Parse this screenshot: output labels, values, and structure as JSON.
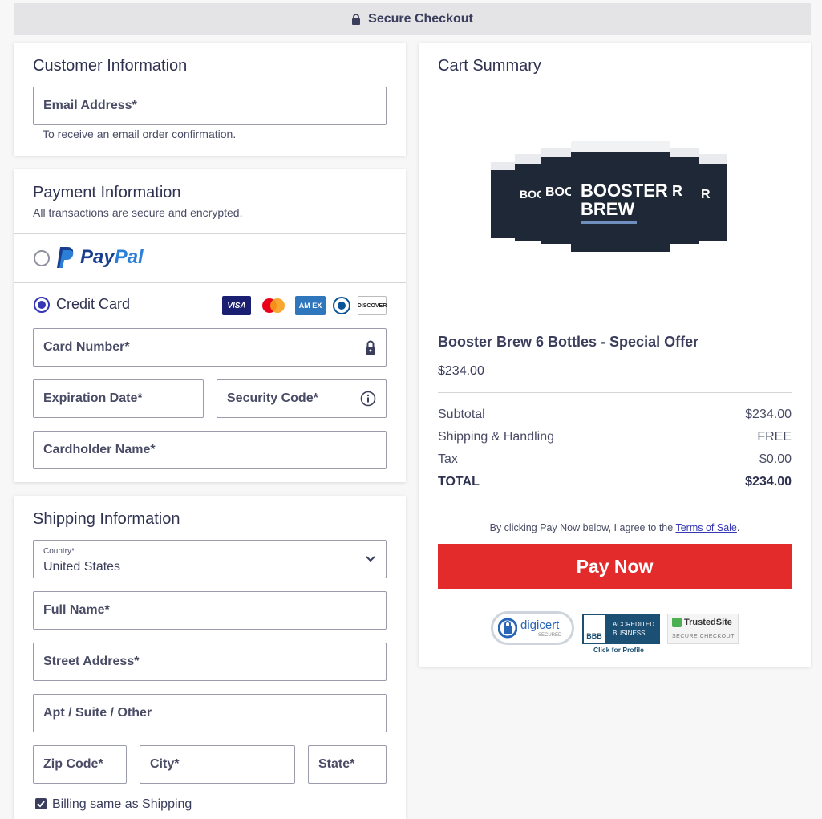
{
  "topbar": {
    "title": "Secure Checkout"
  },
  "customer": {
    "title": "Customer Information",
    "email_label": "Email Address*",
    "email_hint": "To receive an email order confirmation."
  },
  "payment": {
    "title": "Payment Information",
    "subtitle": "All transactions are secure and encrypted.",
    "paypal_pay": "Pay",
    "paypal_pal": "Pal",
    "credit_label": "Credit Card",
    "card_logos": {
      "visa": "VISA",
      "amex": "AM EX",
      "discover": "DISCOVER"
    },
    "card_number_label": "Card Number*",
    "expiration_label": "Expiration Date*",
    "security_label": "Security Code*",
    "cardholder_label": "Cardholder Name*"
  },
  "shipping": {
    "title": "Shipping Information",
    "country_small_label": "Country*",
    "country_value": "United States",
    "full_name_label": "Full Name*",
    "street_label": "Street Address*",
    "apt_label": "Apt / Suite / Other",
    "zip_label": "Zip Code*",
    "city_label": "City*",
    "state_label": "State*",
    "billing_same_label": "Billing same as Shipping",
    "billing_same_checked": true
  },
  "cart": {
    "title": "Cart Summary",
    "product_image_text": {
      "line1": "BOOSTER",
      "line2": "BREW"
    },
    "product_name": "Booster Brew 6 Bottles - Special Offer",
    "product_price": "$234.00",
    "rows": [
      {
        "label": "Subtotal",
        "value": "$234.00"
      },
      {
        "label": "Shipping & Handling",
        "value": "FREE"
      },
      {
        "label": "Tax",
        "value": "$0.00"
      }
    ],
    "total": {
      "label": "TOTAL",
      "value": "$234.00"
    },
    "terms_prefix": "By clicking Pay Now below, I agree to the ",
    "terms_link": "Terms of Sale",
    "terms_suffix": ".",
    "pay_button": "Pay Now",
    "badges": {
      "digicert": "digicert",
      "digicert_sub": "SECURED",
      "bbb": "BBB",
      "bbb_text1": "ACCREDITED",
      "bbb_text2": "BUSINESS",
      "bbb_link": "Click for Profile",
      "trusted": "TrustedSite",
      "trusted_sub": "SECURE CHECKOUT"
    }
  },
  "colors": {
    "accent": "#3537b5",
    "pay_button": "#e32b2b",
    "text": "#3a3d5c",
    "link": "#3537b5"
  }
}
